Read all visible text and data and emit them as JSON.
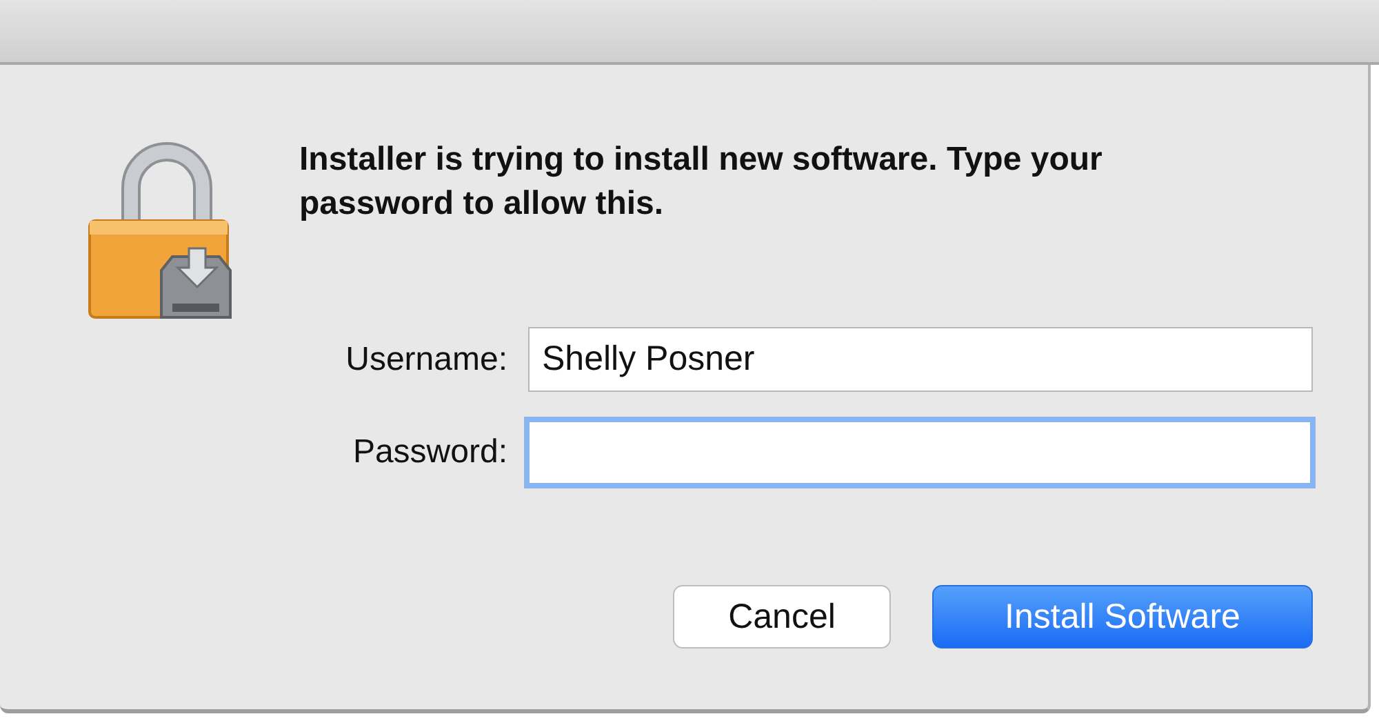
{
  "dialog": {
    "message": "Installer is trying to install new software. Type your password to allow this."
  },
  "fields": [
    {
      "label": "Username:",
      "value": "Shelly Posner",
      "focused": false,
      "kind": "text"
    },
    {
      "label": "Password:",
      "focused": true,
      "kind": "password"
    }
  ],
  "buttons": [
    {
      "label": "Cancel",
      "default": false
    },
    {
      "label": "Install Software",
      "default": true
    }
  ]
}
